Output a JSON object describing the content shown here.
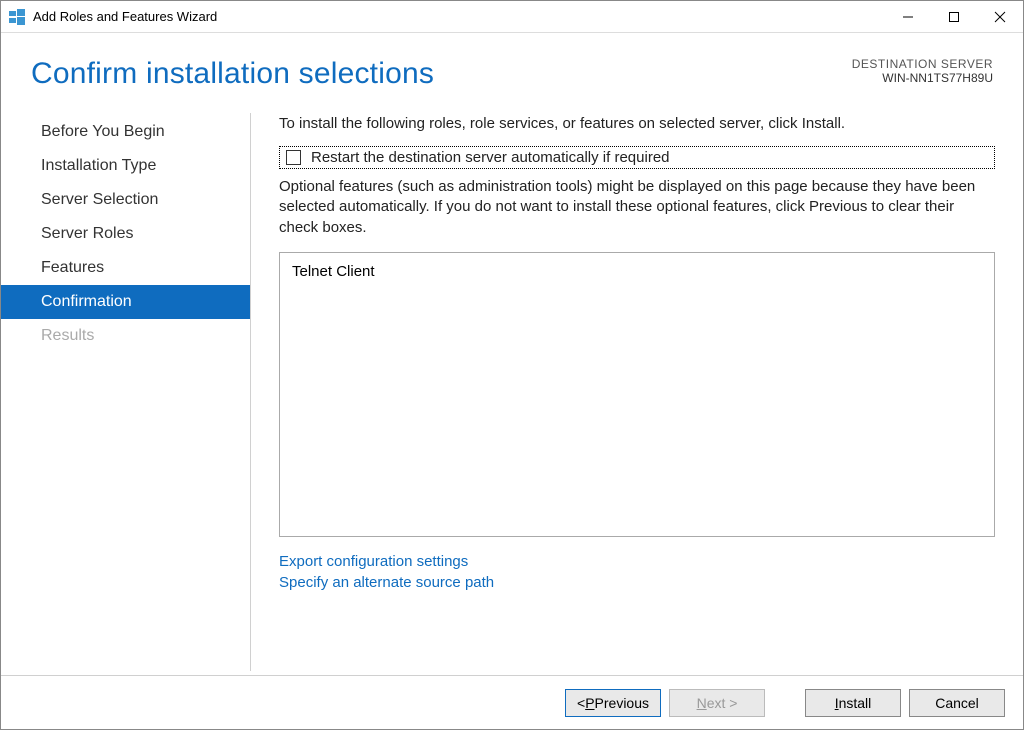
{
  "titlebar": {
    "title": "Add Roles and Features Wizard"
  },
  "header": {
    "page_title": "Confirm installation selections",
    "destination_label": "DESTINATION SERVER",
    "destination_name": "WIN-NN1TS77H89U"
  },
  "sidebar": {
    "items": [
      {
        "label": "Before You Begin",
        "active": false,
        "disabled": false
      },
      {
        "label": "Installation Type",
        "active": false,
        "disabled": false
      },
      {
        "label": "Server Selection",
        "active": false,
        "disabled": false
      },
      {
        "label": "Server Roles",
        "active": false,
        "disabled": false
      },
      {
        "label": "Features",
        "active": false,
        "disabled": false
      },
      {
        "label": "Confirmation",
        "active": true,
        "disabled": false
      },
      {
        "label": "Results",
        "active": false,
        "disabled": true
      }
    ]
  },
  "main": {
    "intro": "To install the following roles, role services, or features on selected server, click Install.",
    "checkbox_label": "Restart the destination server automatically if required",
    "checkbox_checked": false,
    "description": "Optional features (such as administration tools) might be displayed on this page because they have been selected automatically. If you do not want to install these optional features, click Previous to clear their check boxes.",
    "selected_items": [
      "Telnet Client"
    ],
    "links": {
      "export": "Export configuration settings",
      "alt_source": "Specify an alternate source path"
    }
  },
  "footer": {
    "previous": "Previous",
    "next": "Next >",
    "install": "Install",
    "cancel": "Cancel"
  }
}
